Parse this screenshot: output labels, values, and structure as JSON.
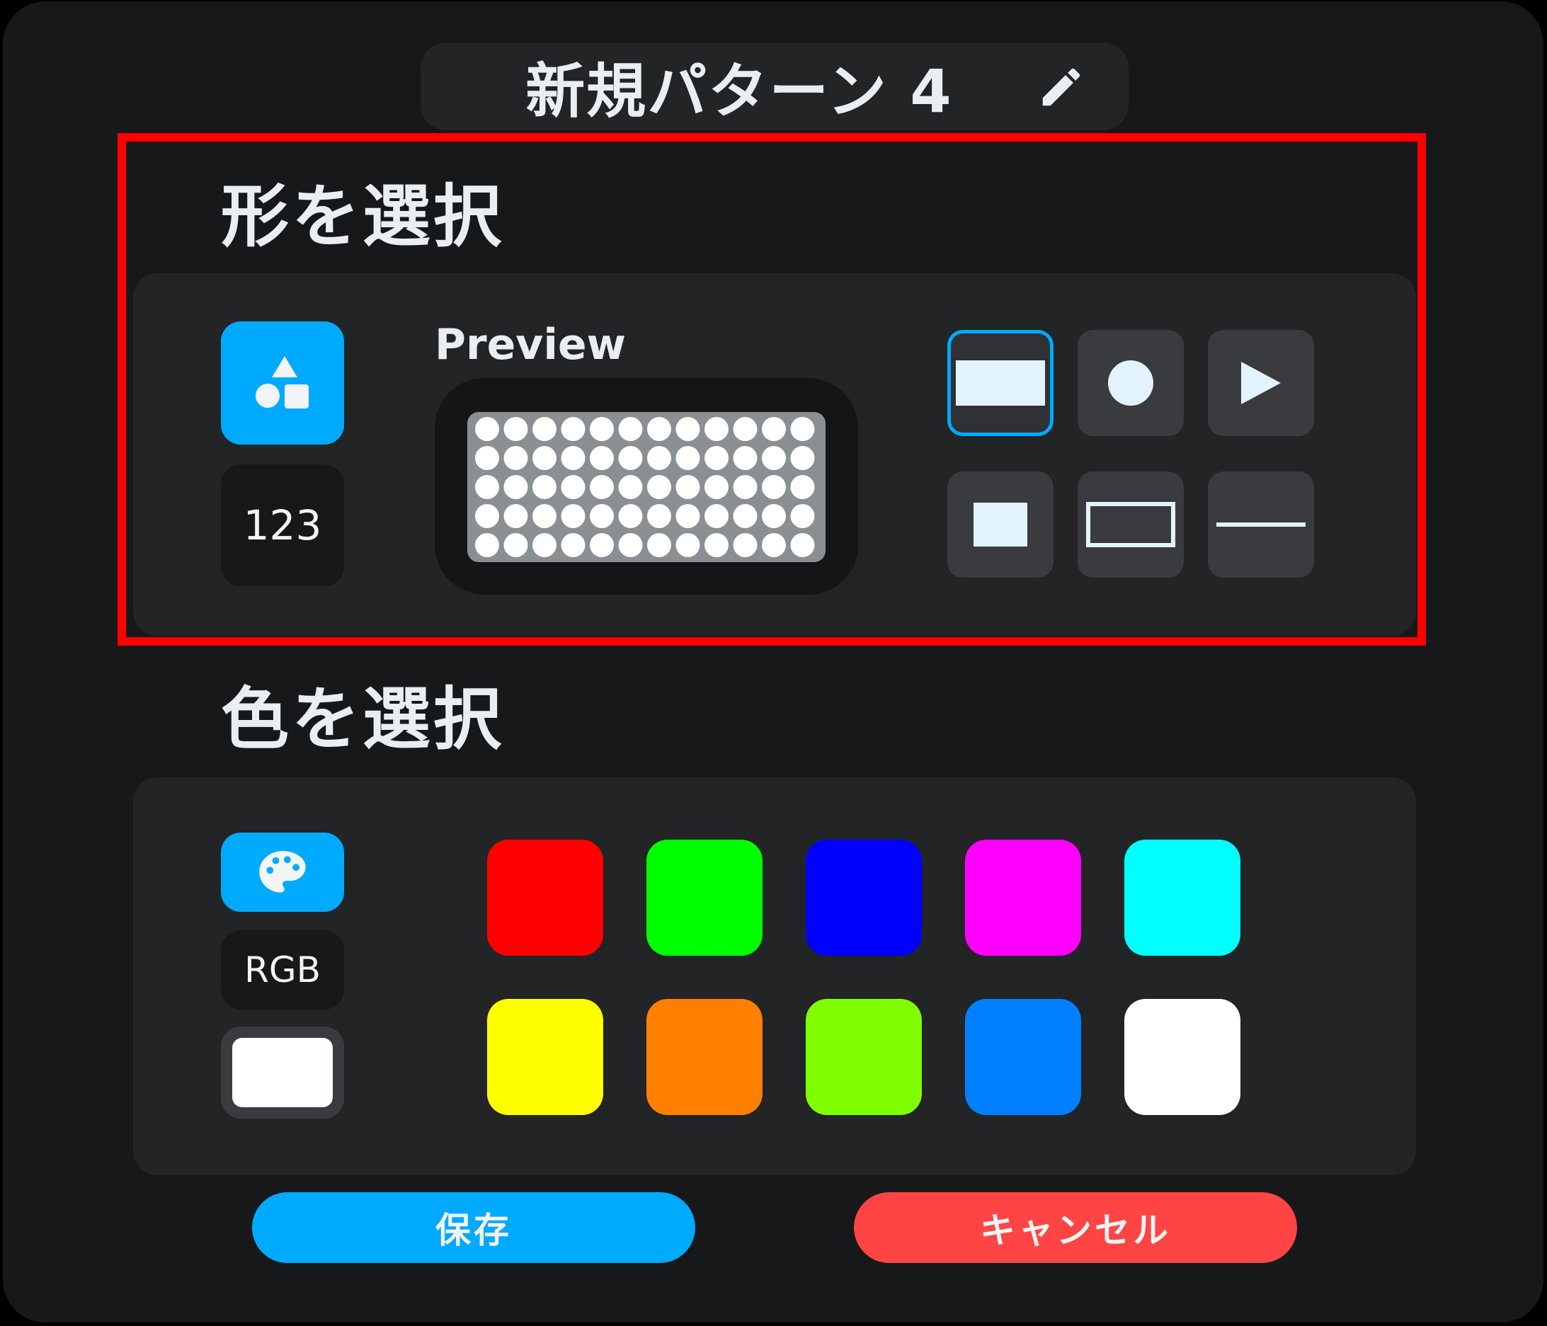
{
  "header": {
    "title": "新規パターン 4",
    "edit_icon": "pencil-icon"
  },
  "shape_section": {
    "title": "形を選択",
    "modes": [
      {
        "name": "shapes",
        "icon": "shapes-icon",
        "active": true
      },
      {
        "name": "numbers",
        "label": "123",
        "active": false
      }
    ],
    "preview_label": "Preview",
    "preview_matrix": {
      "rows": 5,
      "cols": 12,
      "dot_color": "#ffffff",
      "bg_color": "#8a8f94"
    },
    "shapes": [
      {
        "name": "wide-rectangle",
        "selected": true
      },
      {
        "name": "circle",
        "selected": false
      },
      {
        "name": "play-triangle",
        "selected": false
      },
      {
        "name": "square",
        "selected": false
      },
      {
        "name": "rectangle-outline",
        "selected": false
      },
      {
        "name": "line",
        "selected": false
      }
    ],
    "accent_color": "#00aaff"
  },
  "color_section": {
    "title": "色を選択",
    "modes": [
      {
        "name": "palette",
        "icon": "palette-icon",
        "active": true
      },
      {
        "name": "rgb",
        "label": "RGB",
        "active": false
      }
    ],
    "current_color": "#ffffff",
    "swatches": [
      "#ff0000",
      "#00ff00",
      "#0000ff",
      "#ff00ff",
      "#00ffff",
      "#ffff00",
      "#ff8000",
      "#80ff00",
      "#0080ff",
      "#ffffff"
    ]
  },
  "actions": {
    "save_label": "保存",
    "cancel_label": "キャンセル",
    "save_color": "#00aaff",
    "cancel_color": "#ff4444"
  }
}
